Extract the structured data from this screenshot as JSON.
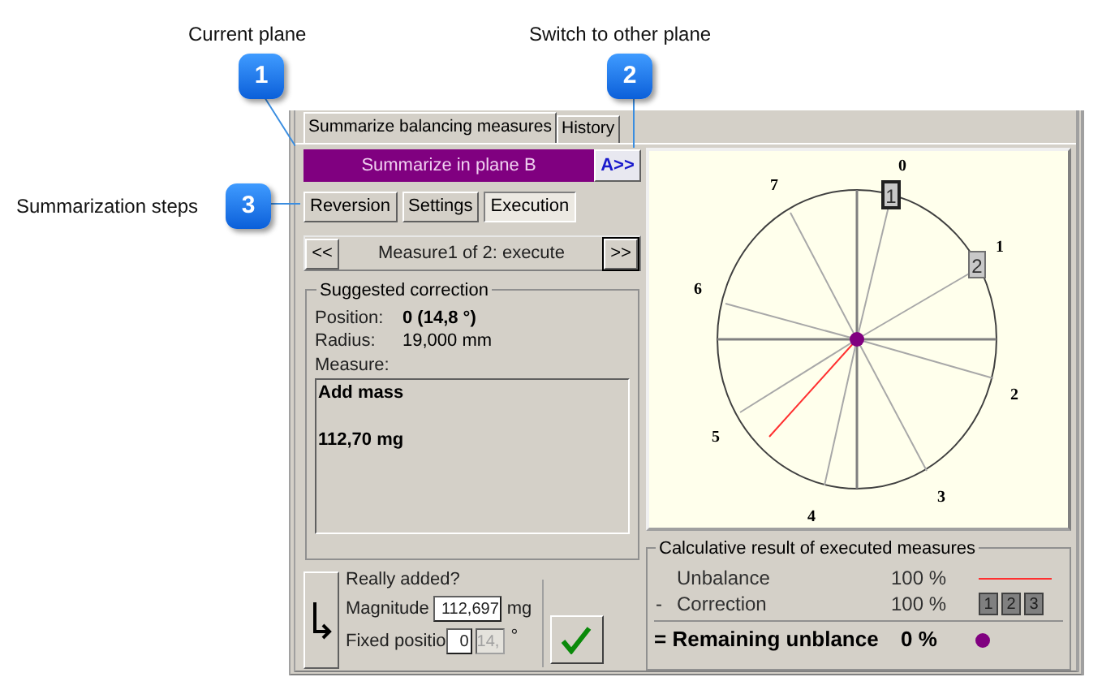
{
  "callouts": [
    {
      "number": "1",
      "label": "Current plane"
    },
    {
      "number": "2",
      "label": "Switch to other plane"
    },
    {
      "number": "3",
      "label": "Summarization steps"
    }
  ],
  "tabs": [
    {
      "label": "Summarize balancing measures",
      "selected": true
    },
    {
      "label": "History",
      "selected": false
    }
  ],
  "plane_bar": {
    "title": "Summarize in plane B",
    "switch_button": "A>>"
  },
  "steps": [
    {
      "label": "Reversion",
      "selected": false
    },
    {
      "label": "Settings",
      "selected": false
    },
    {
      "label": "Execution",
      "selected": true
    }
  ],
  "navigator": {
    "prev": "<<",
    "text": "Measure1 of 2: execute",
    "next": ">>"
  },
  "suggested_correction": {
    "title": "Suggested correction",
    "fields": [
      {
        "label": "Position:",
        "value": "0 (14,8 °)",
        "bold": true
      },
      {
        "label": "Radius:",
        "value": "19,000 mm",
        "bold": false
      }
    ],
    "measure_label": "Measure:",
    "measure_lines": [
      "Add mass",
      "112,70 mg"
    ]
  },
  "really_added": {
    "title": "Really added?",
    "magnitude_label": "Magnitude",
    "magnitude_value": "112,697",
    "magnitude_unit": "mg",
    "fixed_label": "Fixed positio",
    "fixed_value": "0",
    "fixed_angle": "14,",
    "fixed_angle_disabled": true,
    "fixed_unit": "°"
  },
  "diagram": {
    "sector_labels": [
      "0",
      "1",
      "2",
      "3",
      "4",
      "5",
      "6",
      "7"
    ],
    "markers": [
      {
        "label": "1",
        "selected": true
      },
      {
        "label": "2",
        "selected": false
      }
    ]
  },
  "result": {
    "title": "Calculative result of executed measures",
    "rows": [
      {
        "sign": "",
        "label": "Unbalance",
        "value": "100 %",
        "kind": "line"
      },
      {
        "sign": "-",
        "label": "Correction",
        "value": "100 %",
        "kind": "boxes",
        "boxes": [
          "1",
          "2",
          "3"
        ]
      }
    ],
    "total": {
      "label": "= Remaining unblance",
      "value": "0 %"
    }
  }
}
